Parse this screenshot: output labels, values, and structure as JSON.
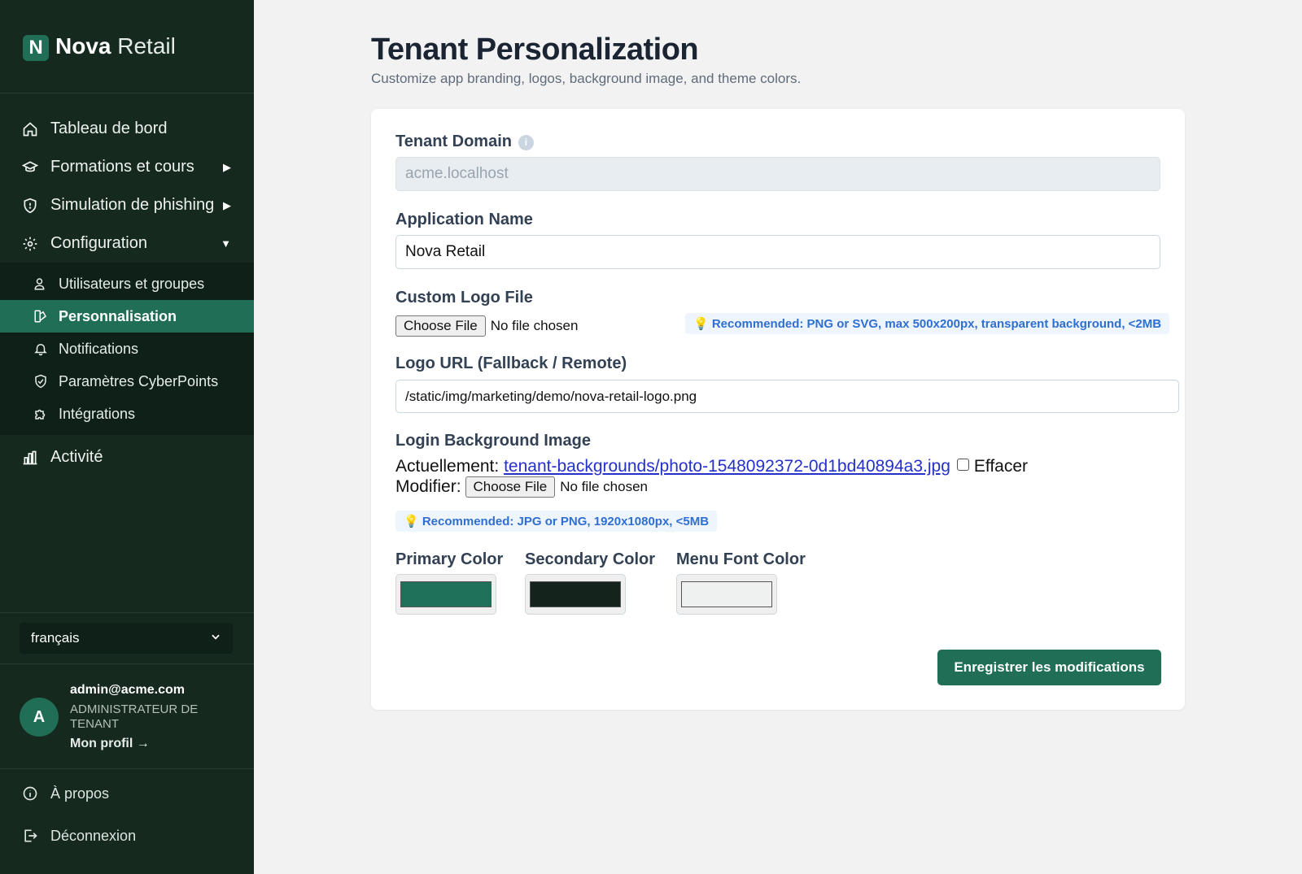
{
  "brand": {
    "name_bold": "Nova",
    "name_light": "Retail",
    "mark": "N"
  },
  "nav": {
    "items": [
      {
        "label": "Tableau de bord",
        "icon": "home-icon"
      },
      {
        "label": "Formations et cours",
        "icon": "graduation-cap-icon",
        "arrow": "▶"
      },
      {
        "label": "Simulation de phishing",
        "icon": "shield-icon",
        "arrow": "▶"
      },
      {
        "label": "Configuration",
        "icon": "gear-icon",
        "arrow": "▼"
      }
    ],
    "subitems": [
      {
        "label": "Utilisateurs et groupes",
        "icon": "users-icon"
      },
      {
        "label": "Personnalisation",
        "icon": "palette-icon",
        "active": true
      },
      {
        "label": "Notifications",
        "icon": "bell-icon"
      },
      {
        "label": "Paramètres CyberPoints",
        "icon": "shield-check-icon"
      },
      {
        "label": "Intégrations",
        "icon": "puzzle-icon"
      }
    ],
    "activity": {
      "label": "Activité",
      "icon": "bar-chart-icon"
    }
  },
  "language": {
    "selected": "français"
  },
  "user": {
    "initial": "A",
    "email": "admin@acme.com",
    "role_line1": "ADMINISTRATEUR DE",
    "role_line2": "TENANT",
    "profile_link": "Mon profil →"
  },
  "bottom_links": [
    {
      "label": "À propos",
      "icon": "info-icon"
    },
    {
      "label": "Déconnexion",
      "icon": "logout-icon"
    }
  ],
  "page": {
    "title": "Tenant Personalization",
    "subtitle": "Customize app branding, logos, background image, and theme colors."
  },
  "form": {
    "tenant_domain": {
      "label": "Tenant Domain",
      "value": "acme.localhost"
    },
    "app_name": {
      "label": "Application Name",
      "value": "Nova Retail"
    },
    "custom_logo": {
      "label": "Custom Logo File",
      "button": "Choose File",
      "status": "No file chosen",
      "hint": "💡 Recommended: PNG or SVG, max 500x200px, transparent background, <2MB"
    },
    "logo_url": {
      "label": "Logo URL (Fallback / Remote)",
      "value": "/static/img/marketing/demo/nova-retail-logo.png"
    },
    "login_bg": {
      "label": "Login Background Image",
      "current_prefix": "Actuellement:",
      "current_link": "tenant-backgrounds/photo-1548092372-0d1bd40894a3.jpg",
      "clear_label": "Effacer",
      "modify_prefix": "Modifier:",
      "button": "Choose File",
      "status": "No file chosen",
      "hint": "💡 Recommended: JPG or PNG, 1920x1080px, <5MB"
    },
    "colors": [
      {
        "label": "Primary Color",
        "value": "#20715a"
      },
      {
        "label": "Secondary Color",
        "value": "#14231c"
      },
      {
        "label": "Menu Font Color",
        "value": "#eef1f0"
      }
    ],
    "save_label": "Enregistrer les modifications"
  }
}
